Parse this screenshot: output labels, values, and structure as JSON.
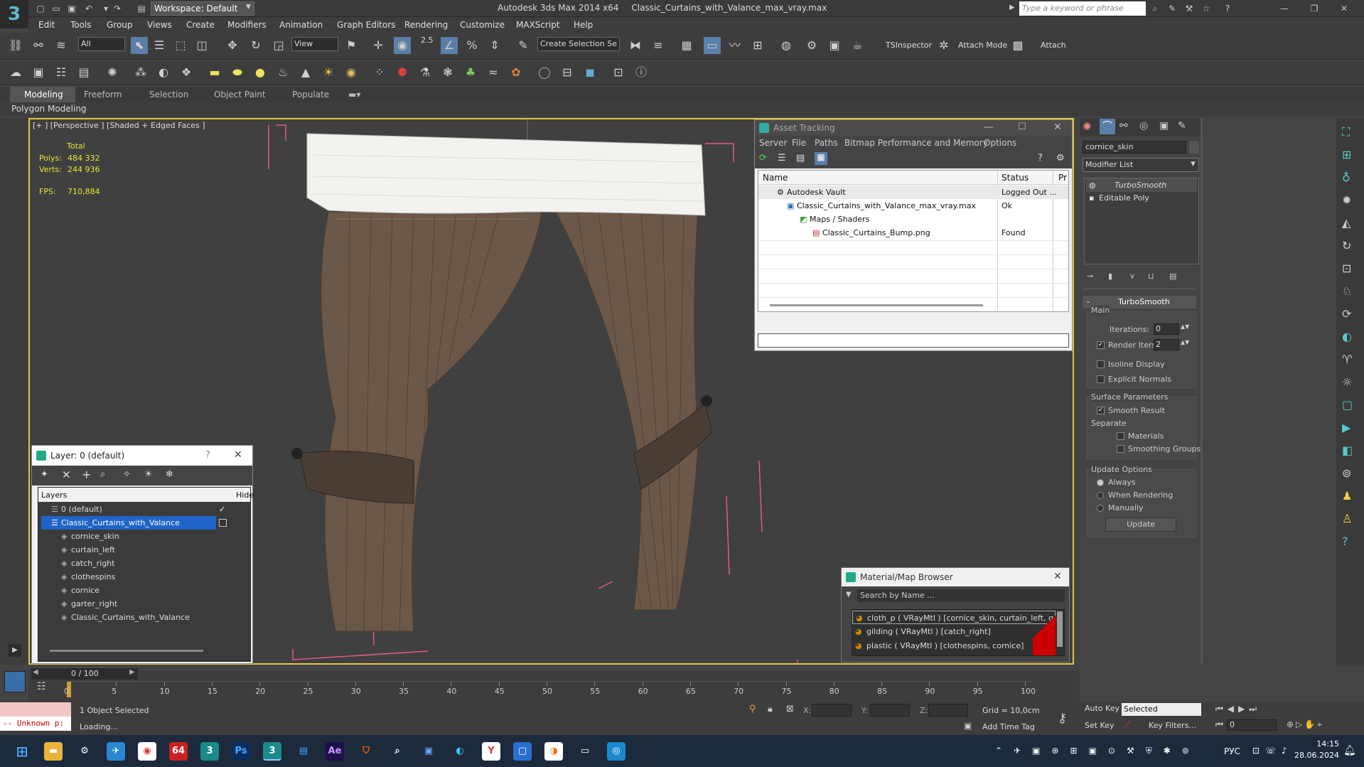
{
  "titlebar": {
    "logo": "3",
    "workspace": "Workspace: Default",
    "app_title": "Autodesk 3ds Max  2014 x64",
    "file_title": "Classic_Curtains_with_Valance_max_vray.max",
    "search_placeholder": "Type a keyword or phrase"
  },
  "menu": [
    "Edit",
    "Tools",
    "Group",
    "Views",
    "Create",
    "Modifiers",
    "Animation",
    "Graph Editors",
    "Rendering",
    "Customize",
    "MAXScript",
    "Help"
  ],
  "main_toolbar": {
    "selection_filter": "All",
    "ref_coord": "View",
    "snap_value": "2.5",
    "selection_set": "Create Selection Se",
    "tsinspector": "TSInspector",
    "attach_mode": "Attach Mode",
    "attach": "Attach"
  },
  "ribbon": {
    "tabs": [
      "Modeling",
      "Freeform",
      "Selection",
      "Object Paint",
      "Populate"
    ],
    "active_tab": "Modeling",
    "subtitle": "Polygon Modeling"
  },
  "viewport": {
    "label": "[+ ] [Perspective ] [Shaded + Edged Faces ]",
    "stats_header": "Total",
    "polys_label": "Polys:",
    "polys_value": "484 332",
    "verts_label": "Verts:",
    "verts_value": "244 936",
    "fps_label": "FPS:",
    "fps_value": "710,884"
  },
  "asset_tracking": {
    "title": "Asset Tracking",
    "menu": [
      "Server",
      "File",
      "Paths",
      "Bitmap Performance and Memory",
      "Options"
    ],
    "columns": [
      "Name",
      "Status",
      "Pr"
    ],
    "rows": [
      {
        "name": "Autodesk Vault",
        "status": "Logged Out ..."
      },
      {
        "name": "Classic_Curtains_with_Valance_max_vray.max",
        "status": "Ok"
      },
      {
        "name": "Maps / Shaders",
        "status": ""
      },
      {
        "name": "Classic_Curtains_Bump.png",
        "status": "Found"
      }
    ]
  },
  "layer_window": {
    "title": "Layer: 0 (default)",
    "help": "?",
    "columns": [
      "Layers",
      "Hide"
    ],
    "items": [
      "0 (default)",
      "Classic_Curtains_with_Valance",
      "cornice_skin",
      "curtain_left",
      "catch_right",
      "clothespins",
      "cornice",
      "garter_right",
      "Classic_Curtains_with_Valance"
    ],
    "selected_item": "Classic_Curtains_with_Valance"
  },
  "material_browser": {
    "title": "Material/Map Browser",
    "search_placeholder": "Search by Name ...",
    "items": [
      "cloth_p  ( VRayMtl ) [cornice_skin, curtain_left, g...",
      "gilding  ( VRayMtl ) [catch_right]",
      "plastic  ( VRayMtl ) [clothespins, cornice]"
    ]
  },
  "command_panel": {
    "object_name": "cornice_skin",
    "modifier_list": "Modifier List",
    "stack": [
      "TurboSmooth",
      "Editable Poly"
    ],
    "rollout_title": "TurboSmooth",
    "main_label": "Main",
    "iterations_label": "Iterations:",
    "iterations_value": "0",
    "render_iters_label": "Render Iters:",
    "render_iters_value": "2",
    "isoline": "Isoline Display",
    "explicit_normals": "Explicit Normals",
    "surface_params": "Surface Parameters",
    "smooth_result": "Smooth Result",
    "separate": "Separate",
    "materials": "Materials",
    "smoothing_groups": "Smoothing Groups",
    "update_options": "Update Options",
    "always": "Always",
    "when_rendering": "When Rendering",
    "manually": "Manually",
    "update_btn": "Update"
  },
  "timeline": {
    "frame_counter": "0 / 100",
    "ticks": [
      "0",
      "5",
      "10",
      "15",
      "20",
      "25",
      "30",
      "35",
      "40",
      "45",
      "50",
      "55",
      "60",
      "65",
      "70",
      "75",
      "80",
      "85",
      "90",
      "95",
      "100"
    ]
  },
  "status": {
    "selected": "1 Object Selected",
    "loading": "Loading...",
    "script": "-- Unknown p:",
    "x_label": "X:",
    "y_label": "Y:",
    "z_label": "Z:",
    "grid": "Grid = 10,0cm",
    "add_time_tag": "Add Time Tag",
    "auto_key": "Auto Key",
    "set_key": "Set Key",
    "selected_dd": "Selected",
    "key_filters": "Key Filters...",
    "frame_field": "0"
  },
  "taskbar": {
    "lang": "РУС",
    "time": "14:15",
    "date": "28.06.2024",
    "badge": "64"
  }
}
